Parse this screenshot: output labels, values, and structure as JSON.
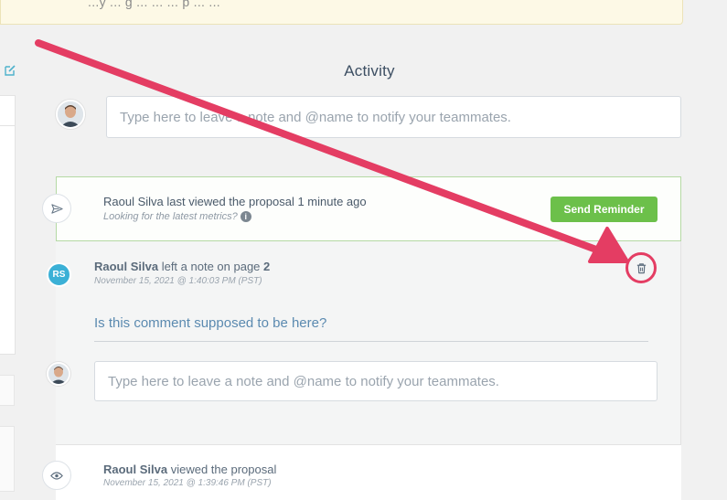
{
  "banner": {
    "text": "...y ... g ... ... ... p ... ..."
  },
  "activity": {
    "title": "Activity"
  },
  "top_note": {
    "placeholder": "Type here to leave a note and @name to notify your teammates."
  },
  "viewed_event": {
    "text": "Raoul Silva last viewed the proposal 1 minute ago",
    "subtext": "Looking for the latest metrics?",
    "button_label": "Send Reminder"
  },
  "note_event": {
    "initials": "RS",
    "author": "Raoul Silva",
    "action": "left a note on page",
    "page": "2",
    "timestamp": "November 15, 2021 @ 1:40:03 PM (PST)",
    "body": "Is this comment supposed to be here?",
    "reply_placeholder": "Type here to leave a note and @name to notify your teammates."
  },
  "bottom_event": {
    "author": "Raoul Silva",
    "action": "viewed the proposal",
    "timestamp": "November 15, 2021 @ 1:39:46 PM (PST)"
  },
  "colors": {
    "accent_green": "#6cc04a",
    "timeline_blue": "#4fb2cc",
    "annotation_pink": "#e43d63"
  },
  "icons": [
    "edit-icon",
    "send-icon",
    "info-icon",
    "trash-icon",
    "eye-icon"
  ]
}
